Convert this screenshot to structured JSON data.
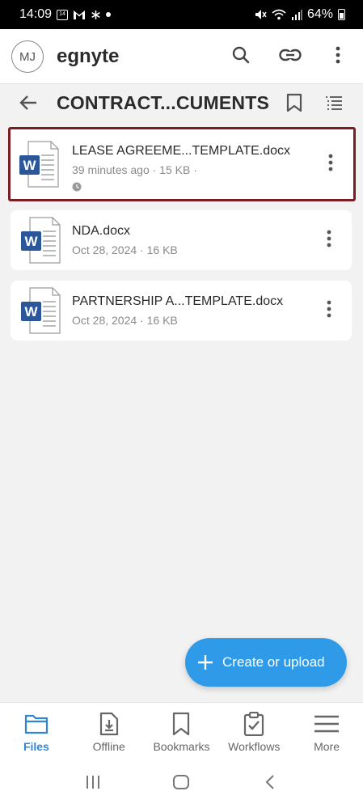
{
  "status_bar": {
    "time": "14:09",
    "battery_text": "64%"
  },
  "header": {
    "avatar_initials": "MJ",
    "brand": "egnyte",
    "icons": [
      "search-icon",
      "link-icon",
      "more-vert-icon"
    ]
  },
  "toolbar": {
    "folder_title": "CONTRACT...CUMENTS",
    "icons": [
      "back-arrow-icon",
      "bookmark-icon",
      "sort-list-icon"
    ]
  },
  "files": [
    {
      "name": "LEASE AGREEME...TEMPLATE.docx",
      "meta": "39 minutes ago · 15 KB ·",
      "pending_icon": "clock-icon",
      "selected": true
    },
    {
      "name": "NDA.docx",
      "meta": "Oct 28, 2024 · 16 KB",
      "selected": false
    },
    {
      "name": "PARTNERSHIP A...TEMPLATE.docx",
      "meta": "Oct 28, 2024 · 16 KB",
      "selected": false
    }
  ],
  "fab": {
    "label": "Create or upload"
  },
  "bottom_nav": {
    "items": [
      {
        "label": "Files",
        "icon": "folder-icon",
        "active": true
      },
      {
        "label": "Offline",
        "icon": "offline-file-icon",
        "active": false
      },
      {
        "label": "Bookmarks",
        "icon": "bookmark-icon",
        "active": false
      },
      {
        "label": "Workflows",
        "icon": "clipboard-check-icon",
        "active": false
      },
      {
        "label": "More",
        "icon": "hamburger-icon",
        "active": false
      }
    ]
  },
  "colors": {
    "accent": "#2f9be8",
    "active_nav": "#2f86d6",
    "selection_border": "#7a1e23",
    "word_blue": "#2b579a"
  }
}
